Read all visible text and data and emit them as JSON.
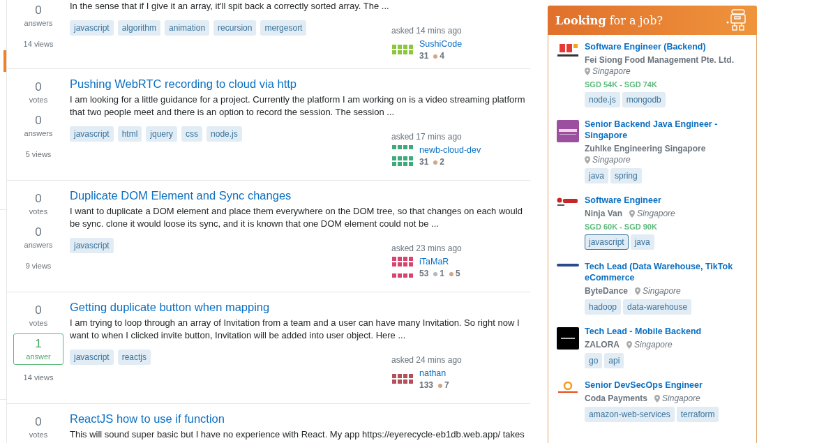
{
  "questions": [
    {
      "answers": "0",
      "answers_label": "answers",
      "answered": false,
      "views": "14 views",
      "excerpt": "In the sense that if I give it an array, it'll spit back a correctly sorted array. The ...",
      "tags": [
        "javascript",
        "algorithm",
        "animation",
        "recursion",
        "mergesort"
      ],
      "asked": "asked 14 mins ago",
      "user": "SushiCode",
      "reputation": "31",
      "badges": [
        {
          "kind": "bronze",
          "count": "4"
        }
      ]
    },
    {
      "votes": "0",
      "votes_label": "votes",
      "answers": "0",
      "answers_label": "answers",
      "answered": false,
      "views": "5 views",
      "title": "Pushing WebRTC recording to cloud via http",
      "excerpt": "I am looking for a little guidance for a project. Currently the platform I am working on is a video streaming platform that two people meet and there is an option to record the session. The session ...",
      "tags": [
        "javascript",
        "html",
        "jquery",
        "css",
        "node.js"
      ],
      "asked": "asked 17 mins ago",
      "user": "newb-cloud-dev",
      "reputation": "31",
      "badges": [
        {
          "kind": "bronze",
          "count": "2"
        }
      ]
    },
    {
      "votes": "0",
      "votes_label": "votes",
      "answers": "0",
      "answers_label": "answers",
      "answered": false,
      "views": "9 views",
      "title": "Duplicate DOM Element and Sync changes",
      "excerpt": "I want to duplicate a DOM element and place them everywhere on the DOM tree, so that changes on each would be sync. clone it would loose its sync, and it is known that one DOM element could not be ...",
      "tags": [
        "javascript"
      ],
      "asked": "asked 23 mins ago",
      "user": "iTaMaR",
      "reputation": "53",
      "badges": [
        {
          "kind": "silver",
          "count": "1"
        },
        {
          "kind": "bronze",
          "count": "5"
        }
      ]
    },
    {
      "votes": "0",
      "votes_label": "votes",
      "answers": "1",
      "answers_label": "answer",
      "answered": true,
      "views": "14 views",
      "title": "Getting duplicate button when mapping",
      "excerpt": "I am trying to loop through an array of Invitation from a team and a user can have many Invitation. So right now I want to when I clicked invite button, Invitation will be added into user object. Here ...",
      "tags": [
        "javascript",
        "reactjs"
      ],
      "asked": "asked 24 mins ago",
      "user": "nathan",
      "reputation": "133",
      "badges": [
        {
          "kind": "bronze",
          "count": "7"
        }
      ]
    },
    {
      "votes": "0",
      "votes_label": "votes",
      "title": "ReactJS how to use if function",
      "excerpt": "This will sound super basic but I have no experience with React. My app https://eyerecycle-eb1db.web.app/ takes"
    }
  ],
  "jobs_panel": {
    "title": "**Looking** for a job?",
    "jobs": [
      {
        "title": "Software Engineer (Backend)",
        "company": "Fei Siong Food Management Pte. Ltd.",
        "location": "Singapore",
        "salary": "SGD 54K - SGD 74K",
        "tags": [
          {
            "label": "node.js",
            "highlighted": false
          },
          {
            "label": "mongodb",
            "highlighted": false
          }
        ]
      },
      {
        "title": "Senior Backend Java Engineer - Singapore",
        "company": "Zuhlke Engineering Singapore",
        "location": "Singapore",
        "tags": [
          {
            "label": "java",
            "highlighted": false
          },
          {
            "label": "spring",
            "highlighted": false
          }
        ]
      },
      {
        "title": "Software Engineer",
        "company": "Ninja Van",
        "location": "Singapore",
        "salary": "SGD 60K - SGD 90K",
        "tags": [
          {
            "label": "javascript",
            "highlighted": true
          },
          {
            "label": "java",
            "highlighted": false
          }
        ]
      },
      {
        "title": "Tech Lead (Data Warehouse, TikTok eCommerce",
        "company": "ByteDance",
        "location": "Singapore",
        "tags": [
          {
            "label": "hadoop",
            "highlighted": false
          },
          {
            "label": "data-warehouse",
            "highlighted": false
          }
        ]
      },
      {
        "title": "Tech Lead - Mobile Backend",
        "company": "ZALORA",
        "location": "Singapore",
        "tags": [
          {
            "label": "go",
            "highlighted": false
          },
          {
            "label": "api",
            "highlighted": false
          }
        ]
      },
      {
        "title": "Senior DevSecOps Engineer",
        "company": "Coda Payments",
        "location": "Singapore",
        "tags": [
          {
            "label": "amazon-web-services",
            "highlighted": false
          },
          {
            "label": "terraform",
            "highlighted": false
          }
        ]
      }
    ]
  }
}
